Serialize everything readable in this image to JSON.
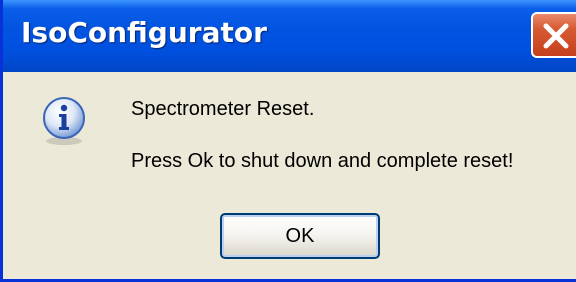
{
  "window": {
    "title": "IsoConfigurator",
    "close_icon": "close-icon"
  },
  "message": {
    "icon": "info-icon",
    "line1": "Spectrometer Reset.",
    "line2": "Press Ok to shut down and complete reset!"
  },
  "buttons": {
    "ok_label": "OK"
  },
  "colors": {
    "titlebar": "#0054e3",
    "dialog_bg": "#ece9d8",
    "close_button": "#d75a33"
  }
}
